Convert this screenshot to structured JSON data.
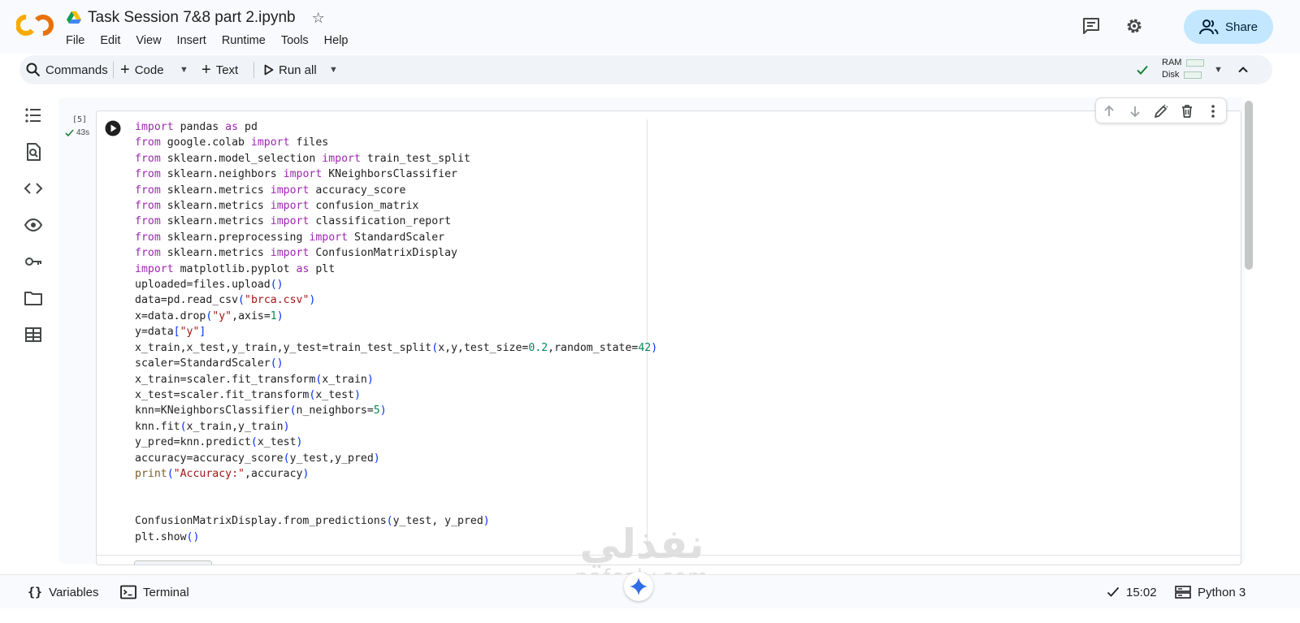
{
  "header": {
    "doc_title": "Task Session 7&8 part 2.ipynb",
    "logo_text": "CO",
    "menu": [
      "File",
      "Edit",
      "View",
      "Insert",
      "Runtime",
      "Tools",
      "Help"
    ],
    "share_label": "Share"
  },
  "toolbar": {
    "commands_label": "Commands",
    "code_label": "Code",
    "text_label": "Text",
    "run_all_label": "Run all",
    "ram_label": "RAM",
    "disk_label": "Disk"
  },
  "cell": {
    "execution_count": "[5]",
    "execution_time": "43s"
  },
  "statusbar": {
    "variables_label": "Variables",
    "terminal_label": "Terminal",
    "time_label": "15:02",
    "kernel_label": "Python 3"
  },
  "watermark": {
    "arabic": "نفذلي",
    "latin": "nafezly.com"
  },
  "colors": {
    "accent": "#c2e7ff",
    "success": "#188038",
    "keyword": "#9c27b0",
    "string": "#a31515",
    "number": "#09885a"
  }
}
